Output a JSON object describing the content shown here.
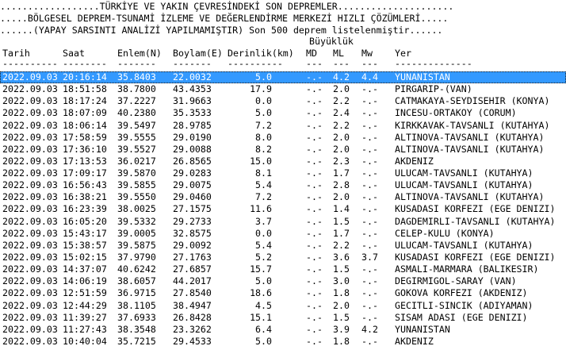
{
  "header": {
    "line1": "..................TÜRKİYE VE YAKIN ÇEVRESİNDEKİ SON DEPREMLER.....................",
    "line2": ".....BÖLGESEL DEPREM-TSUNAMİ İZLEME VE DEĞERLENDİRME MERKEZİ HIZLI ÇÖZÜMLERİ.....",
    "line3": "......(YAPAY SARSINTI ANALİZİ YAPILMAMIŞTIR) Son 500 deprem listelenmiştir......"
  },
  "table": {
    "group_header": "Büyüklük",
    "columns": {
      "date": "Tarih",
      "time": "Saat",
      "lat": "Enlem(N)",
      "lon": "Boylam(E)",
      "depth": "Derinlik(km)",
      "md": "MD",
      "ml": "ML",
      "mw": "Mw",
      "place": "Yer"
    },
    "separators": {
      "date": "----------",
      "time": "--------",
      "lat": "-------",
      "lon": "-------",
      "depth": "----------",
      "md": "---",
      "ml": "---",
      "mw": "---",
      "place": "--------------"
    },
    "rows": [
      {
        "date": "2022.09.03",
        "time": "20:16:14",
        "lat": "35.8403",
        "lon": "22.0032",
        "depth": "5.0",
        "md": "-.-",
        "ml": "4.2",
        "mw": "4.4",
        "place": "YUNANISTAN"
      },
      {
        "date": "2022.09.03",
        "time": "18:51:58",
        "lat": "38.7800",
        "lon": "43.4353",
        "depth": "17.9",
        "md": "-.-",
        "ml": "2.0",
        "mw": "-.-",
        "place": "PIRGARIP-(VAN)"
      },
      {
        "date": "2022.09.03",
        "time": "18:17:24",
        "lat": "37.2227",
        "lon": "31.9663",
        "depth": "0.0",
        "md": "-.-",
        "ml": "2.2",
        "mw": "-.-",
        "place": "CATMAKAYA-SEYDISEHIR (KONYA)"
      },
      {
        "date": "2022.09.03",
        "time": "18:07:09",
        "lat": "40.2380",
        "lon": "35.3533",
        "depth": "5.0",
        "md": "-.-",
        "ml": "2.4",
        "mw": "-.-",
        "place": "INCESU-ORTAKOY (CORUM)"
      },
      {
        "date": "2022.09.03",
        "time": "18:06:14",
        "lat": "39.5497",
        "lon": "28.9785",
        "depth": "7.2",
        "md": "-.-",
        "ml": "2.2",
        "mw": "-.-",
        "place": "KIRKKAVAK-TAVSANLI (KUTAHYA)"
      },
      {
        "date": "2022.09.03",
        "time": "17:58:59",
        "lat": "39.5555",
        "lon": "29.0190",
        "depth": "8.0",
        "md": "-.-",
        "ml": "2.0",
        "mw": "-.-",
        "place": "ALTINOVA-TAVSANLI (KUTAHYA)"
      },
      {
        "date": "2022.09.03",
        "time": "17:36:10",
        "lat": "39.5527",
        "lon": "29.0088",
        "depth": "8.2",
        "md": "-.-",
        "ml": "2.0",
        "mw": "-.-",
        "place": "ALTINOVA-TAVSANLI (KUTAHYA)"
      },
      {
        "date": "2022.09.03",
        "time": "17:13:53",
        "lat": "36.0217",
        "lon": "26.8565",
        "depth": "15.0",
        "md": "-.-",
        "ml": "2.3",
        "mw": "-.-",
        "place": "AKDENIZ"
      },
      {
        "date": "2022.09.03",
        "time": "17:09:17",
        "lat": "39.5870",
        "lon": "29.0283",
        "depth": "8.1",
        "md": "-.-",
        "ml": "1.7",
        "mw": "-.-",
        "place": "ULUCAM-TAVSANLI (KUTAHYA)"
      },
      {
        "date": "2022.09.03",
        "time": "16:56:43",
        "lat": "39.5855",
        "lon": "29.0075",
        "depth": "5.4",
        "md": "-.-",
        "ml": "2.8",
        "mw": "-.-",
        "place": "ULUCAM-TAVSANLI (KUTAHYA)"
      },
      {
        "date": "2022.09.03",
        "time": "16:38:21",
        "lat": "39.5550",
        "lon": "29.0460",
        "depth": "7.2",
        "md": "-.-",
        "ml": "2.0",
        "mw": "-.-",
        "place": "ALTINOVA-TAVSANLI (KUTAHYA)"
      },
      {
        "date": "2022.09.03",
        "time": "16:23:39",
        "lat": "38.0025",
        "lon": "27.1575",
        "depth": "11.6",
        "md": "-.-",
        "ml": "1.4",
        "mw": "-.-",
        "place": "KUSADASI KORFEZI (EGE DENIZI)"
      },
      {
        "date": "2022.09.03",
        "time": "16:05:20",
        "lat": "39.5332",
        "lon": "29.2733",
        "depth": "3.7",
        "md": "-.-",
        "ml": "1.5",
        "mw": "-.-",
        "place": "DAGDEMIRLI-TAVSANLI (KUTAHYA)"
      },
      {
        "date": "2022.09.03",
        "time": "15:43:17",
        "lat": "39.0005",
        "lon": "32.8575",
        "depth": "0.0",
        "md": "-.-",
        "ml": "1.7",
        "mw": "-.-",
        "place": "CELEP-KULU (KONYA)"
      },
      {
        "date": "2022.09.03",
        "time": "15:38:57",
        "lat": "39.5875",
        "lon": "29.0092",
        "depth": "5.4",
        "md": "-.-",
        "ml": "2.2",
        "mw": "-.-",
        "place": "ULUCAM-TAVSANLI (KUTAHYA)"
      },
      {
        "date": "2022.09.03",
        "time": "15:02:15",
        "lat": "37.9790",
        "lon": "27.1763",
        "depth": "5.2",
        "md": "-.-",
        "ml": "3.6",
        "mw": "3.7",
        "place": "KUSADASI KORFEZI (EGE DENIZI)"
      },
      {
        "date": "2022.09.03",
        "time": "14:37:07",
        "lat": "40.6242",
        "lon": "27.6857",
        "depth": "15.7",
        "md": "-.-",
        "ml": "1.5",
        "mw": "-.-",
        "place": "ASMALI-MARMARA (BALIKESIR)"
      },
      {
        "date": "2022.09.03",
        "time": "14:06:19",
        "lat": "38.6057",
        "lon": "44.2017",
        "depth": "5.0",
        "md": "-.-",
        "ml": "3.0",
        "mw": "-.-",
        "place": "DEGIRMIGOL-SARAY (VAN)"
      },
      {
        "date": "2022.09.03",
        "time": "12:51:59",
        "lat": "36.9715",
        "lon": "27.8540",
        "depth": "18.6",
        "md": "-.-",
        "ml": "1.8",
        "mw": "-.-",
        "place": "GOKOVA KORFEZI (AKDENIZ)"
      },
      {
        "date": "2022.09.03",
        "time": "12:44:29",
        "lat": "38.1105",
        "lon": "38.4947",
        "depth": "4.5",
        "md": "-.-",
        "ml": "2.0",
        "mw": "-.-",
        "place": "GECITLI-SINCIK (ADIYAMAN)"
      },
      {
        "date": "2022.09.03",
        "time": "11:39:27",
        "lat": "37.6933",
        "lon": "26.8428",
        "depth": "15.1",
        "md": "-.-",
        "ml": "1.5",
        "mw": "-.-",
        "place": "SISAM ADASI (EGE DENIZI)"
      },
      {
        "date": "2022.09.03",
        "time": "11:27:43",
        "lat": "38.3548",
        "lon": "23.3262",
        "depth": "6.4",
        "md": "-.-",
        "ml": "3.9",
        "mw": "4.2",
        "place": "YUNANISTAN"
      },
      {
        "date": "2022.09.03",
        "time": "10:40:04",
        "lat": "35.7215",
        "lon": "29.4533",
        "depth": "5.0",
        "md": "-.-",
        "ml": "1.8",
        "mw": "-.-",
        "place": "AKDENIZ"
      }
    ]
  }
}
